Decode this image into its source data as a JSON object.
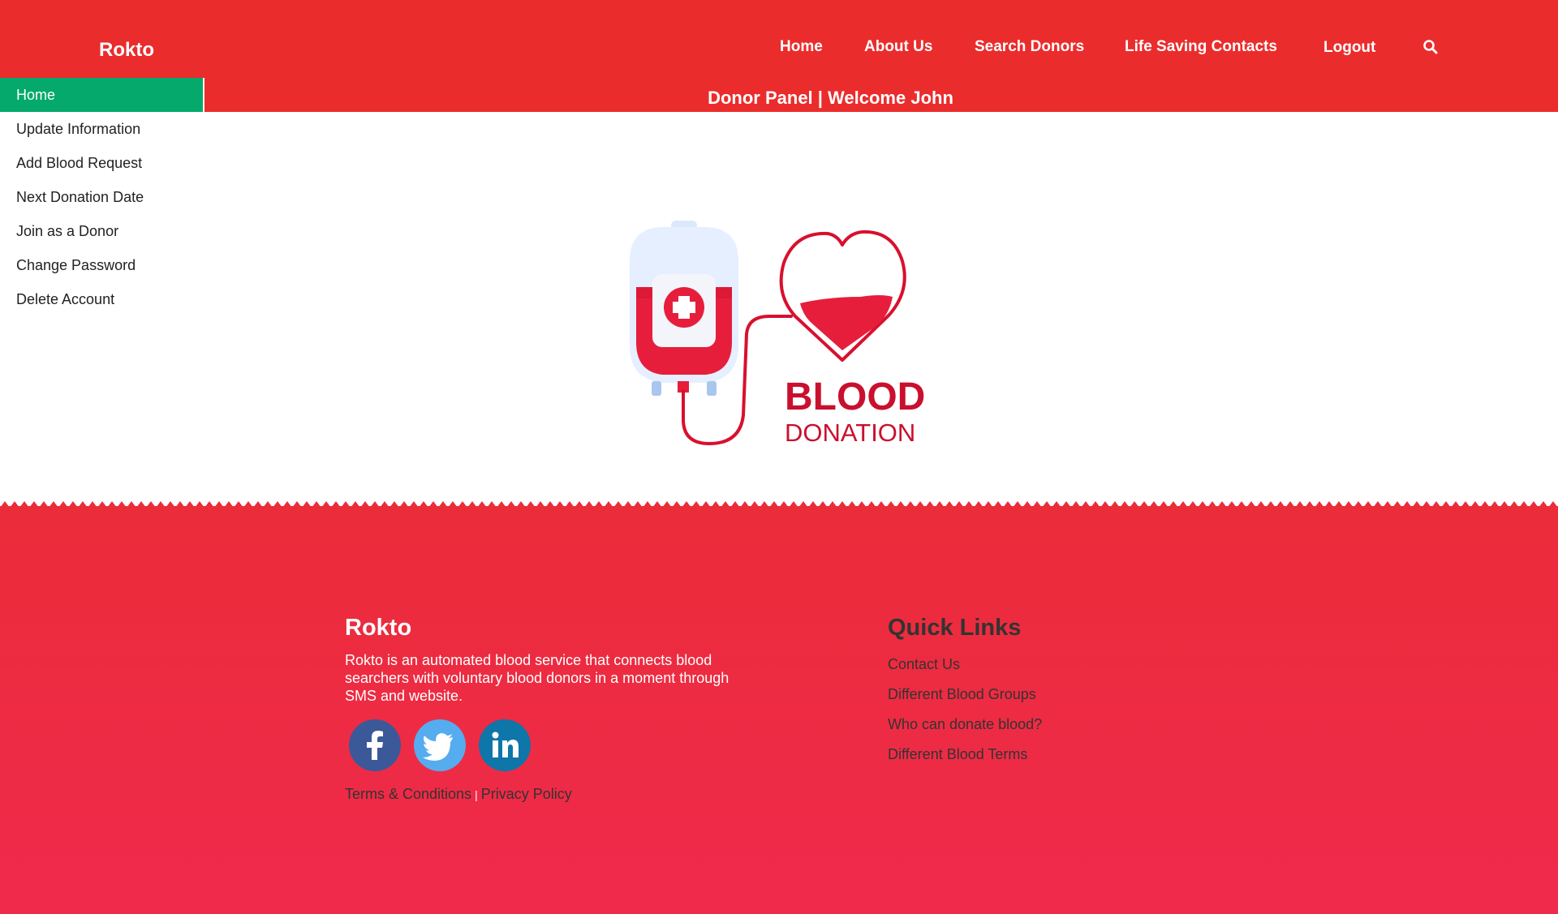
{
  "header": {
    "brand": "Rokto",
    "nav": [
      "Home",
      "About Us",
      "Search Donors",
      "Life Saving Contacts",
      "Logout"
    ]
  },
  "panel": {
    "title": "Donor Panel | Welcome John"
  },
  "sidebar": {
    "items": [
      {
        "label": "Home",
        "active": true
      },
      {
        "label": "Update Information"
      },
      {
        "label": "Add Blood Request"
      },
      {
        "label": "Next Donation Date"
      },
      {
        "label": "Join as a Donor"
      },
      {
        "label": "Change Password"
      },
      {
        "label": "Delete Account"
      }
    ]
  },
  "hero": {
    "line1": "BLOOD",
    "line2": "DONATION"
  },
  "footer": {
    "title": "Rokto",
    "description": "Rokto is an automated blood service that connects blood searchers with voluntary blood donors in a moment through SMS and website.",
    "socials": [
      "facebook-icon",
      "twitter-icon",
      "linkedin-icon"
    ],
    "terms": "Terms & Conditions",
    "separator": "|",
    "privacy": "Privacy Policy",
    "quick_links_title": "Quick Links",
    "quick_links": [
      "Contact Us",
      "Different Blood Groups",
      "Who can donate blood?",
      "Different Blood Terms"
    ]
  },
  "colors": {
    "header_red": "#eb2c2c",
    "active_green": "#04a96b",
    "facebook": "#3b5998",
    "twitter": "#55acee",
    "linkedin": "#0e76a8"
  }
}
